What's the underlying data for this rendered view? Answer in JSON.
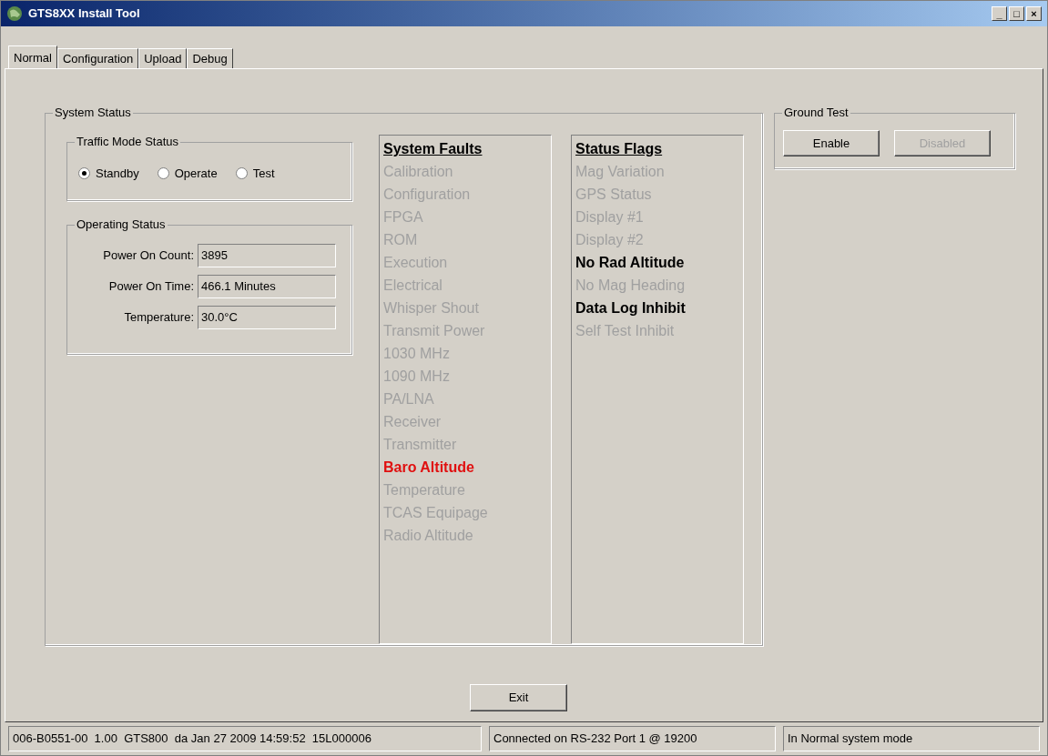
{
  "window": {
    "title": "GTS8XX Install Tool",
    "controls": [
      "_",
      "□",
      "×"
    ]
  },
  "tabs": [
    {
      "label": "Normal",
      "selected": true
    },
    {
      "label": "Configuration",
      "selected": false
    },
    {
      "label": "Upload",
      "selected": false
    },
    {
      "label": "Debug",
      "selected": false
    }
  ],
  "system_status": {
    "title": "System Status",
    "traffic_mode": {
      "title": "Traffic Mode Status",
      "options": [
        {
          "label": "Standby",
          "selected": true
        },
        {
          "label": "Operate",
          "selected": false
        },
        {
          "label": "Test",
          "selected": false
        }
      ]
    },
    "operating_status": {
      "title": "Operating Status",
      "fields": [
        {
          "label": "Power On Count:",
          "value": "3895"
        },
        {
          "label": "Power On Time:",
          "value": "466.1 Minutes"
        },
        {
          "label": "Temperature:",
          "value": "30.0°C"
        }
      ]
    },
    "system_faults": {
      "title": "System Faults",
      "items": [
        {
          "label": "Calibration",
          "kind": "inactive"
        },
        {
          "label": "Configuration",
          "kind": "inactive"
        },
        {
          "label": "FPGA",
          "kind": "inactive"
        },
        {
          "label": "ROM",
          "kind": "inactive"
        },
        {
          "label": "Execution",
          "kind": "inactive"
        },
        {
          "label": "Electrical",
          "kind": "inactive"
        },
        {
          "label": "Whisper Shout",
          "kind": "inactive"
        },
        {
          "label": "Transmit Power",
          "kind": "inactive"
        },
        {
          "label": "1030 MHz",
          "kind": "inactive"
        },
        {
          "label": "1090 MHz",
          "kind": "inactive"
        },
        {
          "label": "PA/LNA",
          "kind": "inactive"
        },
        {
          "label": "Receiver",
          "kind": "inactive"
        },
        {
          "label": "Transmitter",
          "kind": "inactive"
        },
        {
          "label": "Baro Altitude",
          "kind": "fault"
        },
        {
          "label": "Temperature",
          "kind": "inactive"
        },
        {
          "label": "TCAS Equipage",
          "kind": "inactive"
        },
        {
          "label": "Radio Altitude",
          "kind": "inactive"
        }
      ]
    },
    "status_flags": {
      "title": "Status Flags",
      "items": [
        {
          "label": "Mag Variation",
          "kind": "inactive"
        },
        {
          "label": "GPS Status",
          "kind": "inactive"
        },
        {
          "label": "Display #1",
          "kind": "inactive"
        },
        {
          "label": "Display #2",
          "kind": "inactive"
        },
        {
          "label": "No Rad Altitude",
          "kind": "active"
        },
        {
          "label": "No Mag Heading",
          "kind": "inactive"
        },
        {
          "label": "Data Log Inhibit",
          "kind": "active"
        },
        {
          "label": "Self Test Inhibit",
          "kind": "inactive"
        }
      ]
    }
  },
  "ground_test": {
    "title": "Ground Test",
    "buttons": [
      {
        "label": "Enable",
        "disabled": false
      },
      {
        "label": "Disabled",
        "disabled": true
      }
    ]
  },
  "exit_button": "Exit",
  "status_bar": [
    "006-B0551-00  1.00  GTS800  da Jan 27 2009 14:59:52  15L000006",
    "Connected on RS-232 Port 1 @ 19200",
    "In Normal system mode"
  ]
}
